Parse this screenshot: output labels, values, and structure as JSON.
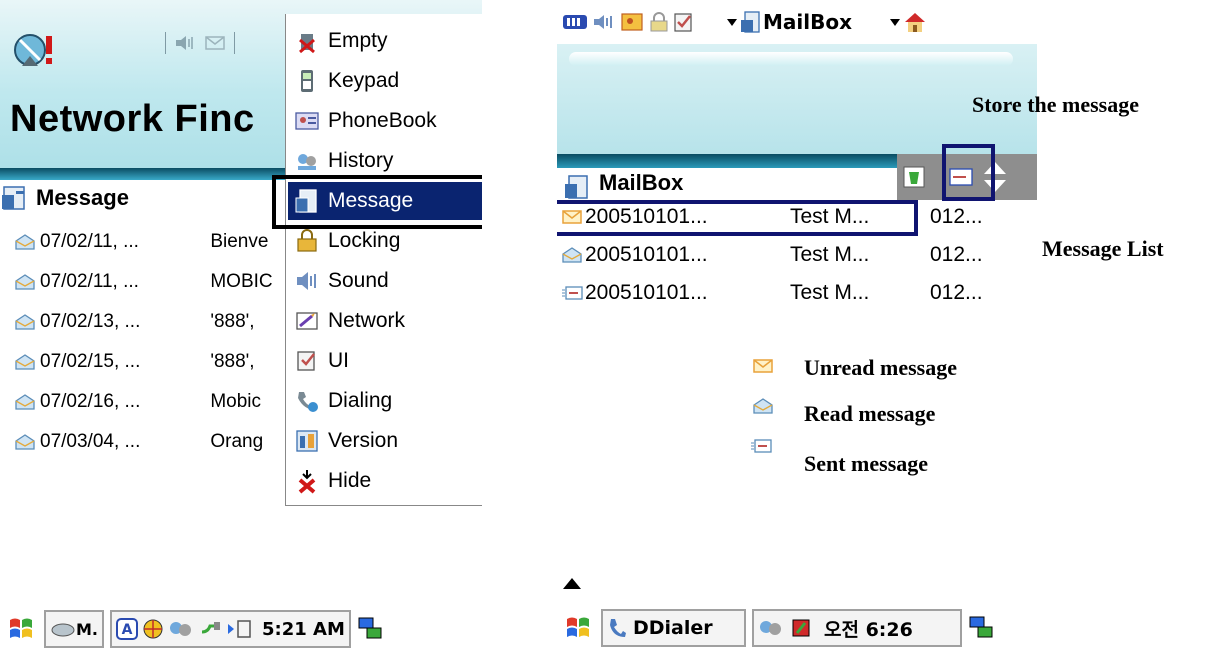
{
  "left_screen": {
    "title": "Network Finc",
    "section_label": "Message",
    "messages": [
      {
        "date": "07/02/11, ...",
        "subject": "Bienve"
      },
      {
        "date": "07/02/11, ...",
        "subject": "MOBIC"
      },
      {
        "date": "07/02/13, ...",
        "subject": "'888',"
      },
      {
        "date": "07/02/15, ...",
        "subject": "'888',"
      },
      {
        "date": "07/02/16, ...",
        "subject": "Mobic"
      },
      {
        "date": "07/03/04, ...",
        "subject": "Orang"
      }
    ],
    "menu": {
      "items": [
        {
          "label": "Empty",
          "icon": "empty-icon"
        },
        {
          "label": "Keypad",
          "icon": "keypad-icon"
        },
        {
          "label": "PhoneBook",
          "icon": "phonebook-icon"
        },
        {
          "label": "History",
          "icon": "history-icon"
        },
        {
          "label": "Message",
          "icon": "message-icon",
          "selected": true
        },
        {
          "label": "Locking",
          "icon": "locking-icon"
        },
        {
          "label": "Sound",
          "icon": "sound-icon"
        },
        {
          "label": "Network",
          "icon": "network-icon"
        },
        {
          "label": "UI",
          "icon": "ui-icon"
        },
        {
          "label": "Dialing",
          "icon": "dialing-icon"
        },
        {
          "label": "Version",
          "icon": "version-icon"
        },
        {
          "label": "Hide",
          "icon": "hide-icon"
        }
      ]
    },
    "taskbar": {
      "app_button": "M.",
      "clock": "5:21 AM"
    }
  },
  "right_screen": {
    "titlebar_label": "MailBox",
    "section_label": "MailBox",
    "messages": [
      {
        "type": "unread",
        "date": "200510101...",
        "subject": "Test M...",
        "from": "012..."
      },
      {
        "type": "read",
        "date": "200510101...",
        "subject": "Test M...",
        "from": "012..."
      },
      {
        "type": "sent",
        "date": "200510101...",
        "subject": "Test M...",
        "from": "012..."
      }
    ],
    "taskbar": {
      "app_button": "DDialer",
      "clock": "오전 6:26"
    }
  },
  "annotations": {
    "store_message": "Store the message",
    "message_list": "Message List",
    "legend": {
      "unread": "Unread message",
      "read": "Read message",
      "sent": "Sent message"
    }
  },
  "colors": {
    "selection": "#0a2470",
    "highlight_box": "#101470",
    "header_band": "#0a4c62"
  }
}
